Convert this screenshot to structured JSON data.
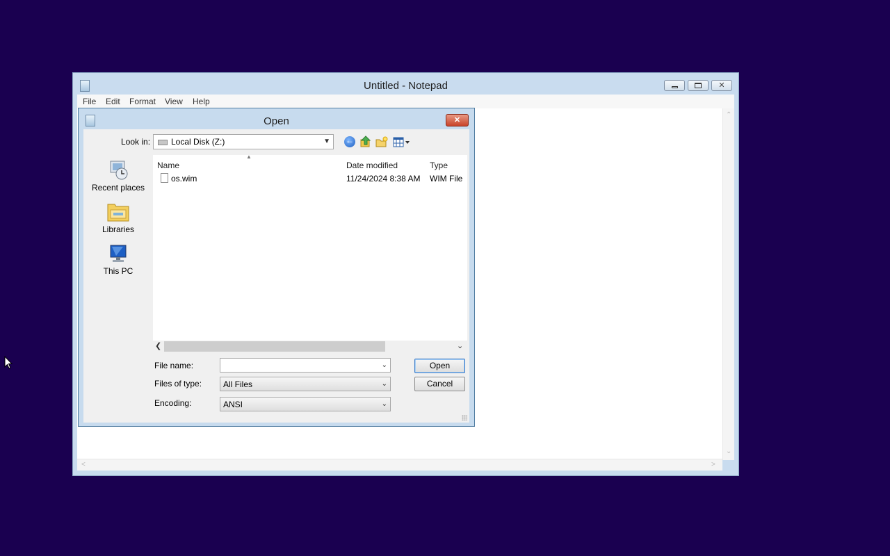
{
  "notepad": {
    "title": "Untitled - Notepad",
    "menu": [
      "File",
      "Edit",
      "Format",
      "View",
      "Help"
    ]
  },
  "dialog": {
    "title": "Open",
    "look_in_label": "Look in:",
    "look_in_value": "Local Disk (Z:)",
    "places": [
      "Recent places",
      "Libraries",
      "This PC"
    ],
    "columns": [
      "Name",
      "Date modified",
      "Type"
    ],
    "files": [
      {
        "name": "os.wim",
        "date": "11/24/2024 8:38 AM",
        "type": "WIM File"
      }
    ],
    "file_name_label": "File name:",
    "file_name_value": "",
    "files_of_type_label": "Files of type:",
    "files_of_type_value": "All Files",
    "encoding_label": "Encoding:",
    "encoding_value": "ANSI",
    "open_label": "Open",
    "cancel_label": "Cancel"
  },
  "colors": {
    "desktop": "#1a0050",
    "window_frame": "#c9dcef",
    "close_red": "#c8432a"
  }
}
